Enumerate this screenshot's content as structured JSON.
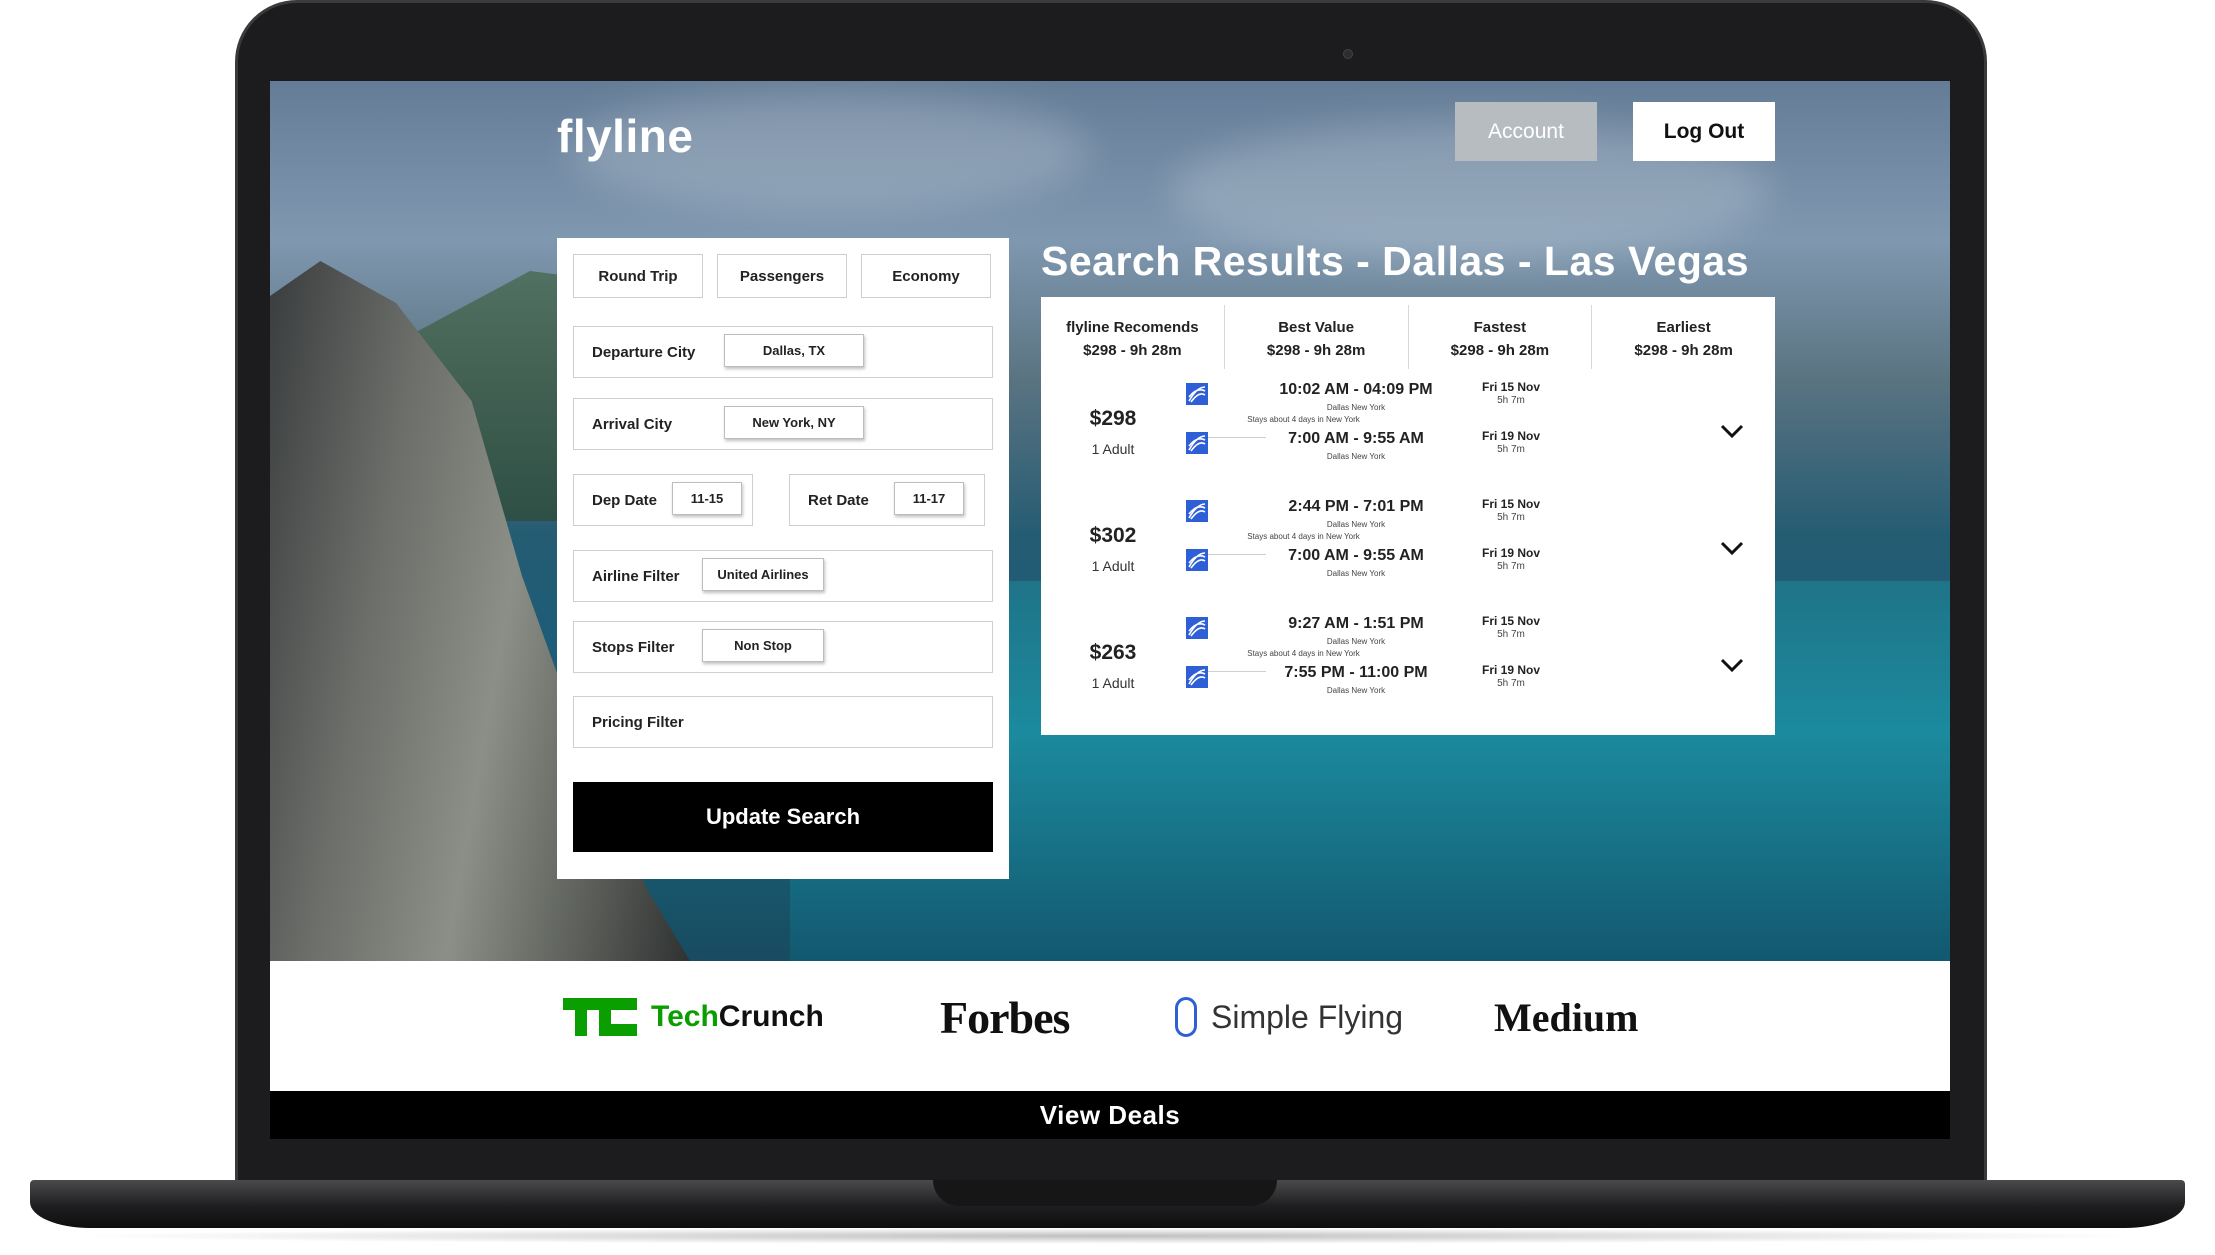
{
  "header": {
    "logo": "flyline",
    "account_label": "Account",
    "logout_label": "Log Out"
  },
  "search_panel": {
    "tabs": [
      "Round Trip",
      "Passengers",
      "Economy"
    ],
    "departure": {
      "label": "Departure City",
      "value": "Dallas, TX"
    },
    "arrival": {
      "label": "Arrival City",
      "value": "New York, NY"
    },
    "dep_date": {
      "label": "Dep Date",
      "value": "11-15"
    },
    "ret_date": {
      "label": "Ret Date",
      "value": "11-17"
    },
    "airline_filter": {
      "label": "Airline Filter",
      "value": "United Airlines"
    },
    "stops_filter": {
      "label": "Stops Filter",
      "value": "Non Stop"
    },
    "pricing_filter": {
      "label": "Pricing Filter"
    },
    "update_label": "Update Search"
  },
  "results": {
    "title": "Search Results - Dallas - Las Vegas",
    "sort_options": [
      {
        "name": "flyline Recomends",
        "value": "$298 - 9h 28m"
      },
      {
        "name": "Best Value",
        "value": "$298 - 9h 28m"
      },
      {
        "name": "Fastest",
        "value": "$298 - 9h 28m"
      },
      {
        "name": "Earliest",
        "value": "$298 - 9h 28m"
      }
    ],
    "flights": [
      {
        "price": "$298",
        "pax": "1 Adult",
        "out_times": "10:02 AM - 04:09 PM",
        "out_cities": "Dallas  New York",
        "stays": "Stays about 4 days in New York",
        "ret_times": "7:00 AM - 9:55 AM",
        "ret_cities": "Dallas  New York",
        "out_day": "Fri 15 Nov",
        "out_dur": "5h 7m",
        "ret_day": "Fri 19 Nov",
        "ret_dur": "5h 7m"
      },
      {
        "price": "$302",
        "pax": "1 Adult",
        "out_times": "2:44 PM - 7:01 PM",
        "out_cities": "Dallas  New York",
        "stays": "Stays about 4 days in New York",
        "ret_times": "7:00 AM - 9:55 AM",
        "ret_cities": "Dallas  New York",
        "out_day": "Fri 15 Nov",
        "out_dur": "5h 7m",
        "ret_day": "Fri 19 Nov",
        "ret_dur": "5h 7m"
      },
      {
        "price": "$263",
        "pax": "1 Adult",
        "out_times": "9:27 AM - 1:51 PM",
        "out_cities": "Dallas  New York",
        "stays": "Stays about 4 days in New York",
        "ret_times": "7:55 PM - 11:00 PM",
        "ret_cities": "Dallas  New York",
        "out_day": "Fri 15 Nov",
        "out_dur": "5h 7m",
        "ret_day": "Fri 19 Nov",
        "ret_dur": "5h 7m"
      }
    ]
  },
  "press": {
    "techcrunch": "TechCrunch",
    "techcrunch_mark": "TC",
    "forbes": "Forbes",
    "simple_flying": "Simple Flying",
    "medium": "Medium"
  },
  "footer": {
    "deals_label": "View Deals"
  },
  "colors": {
    "airline_logo": "#2f5fd6",
    "techcrunch_green": "#0a9e01",
    "account_bg": "#b7bcc1"
  }
}
